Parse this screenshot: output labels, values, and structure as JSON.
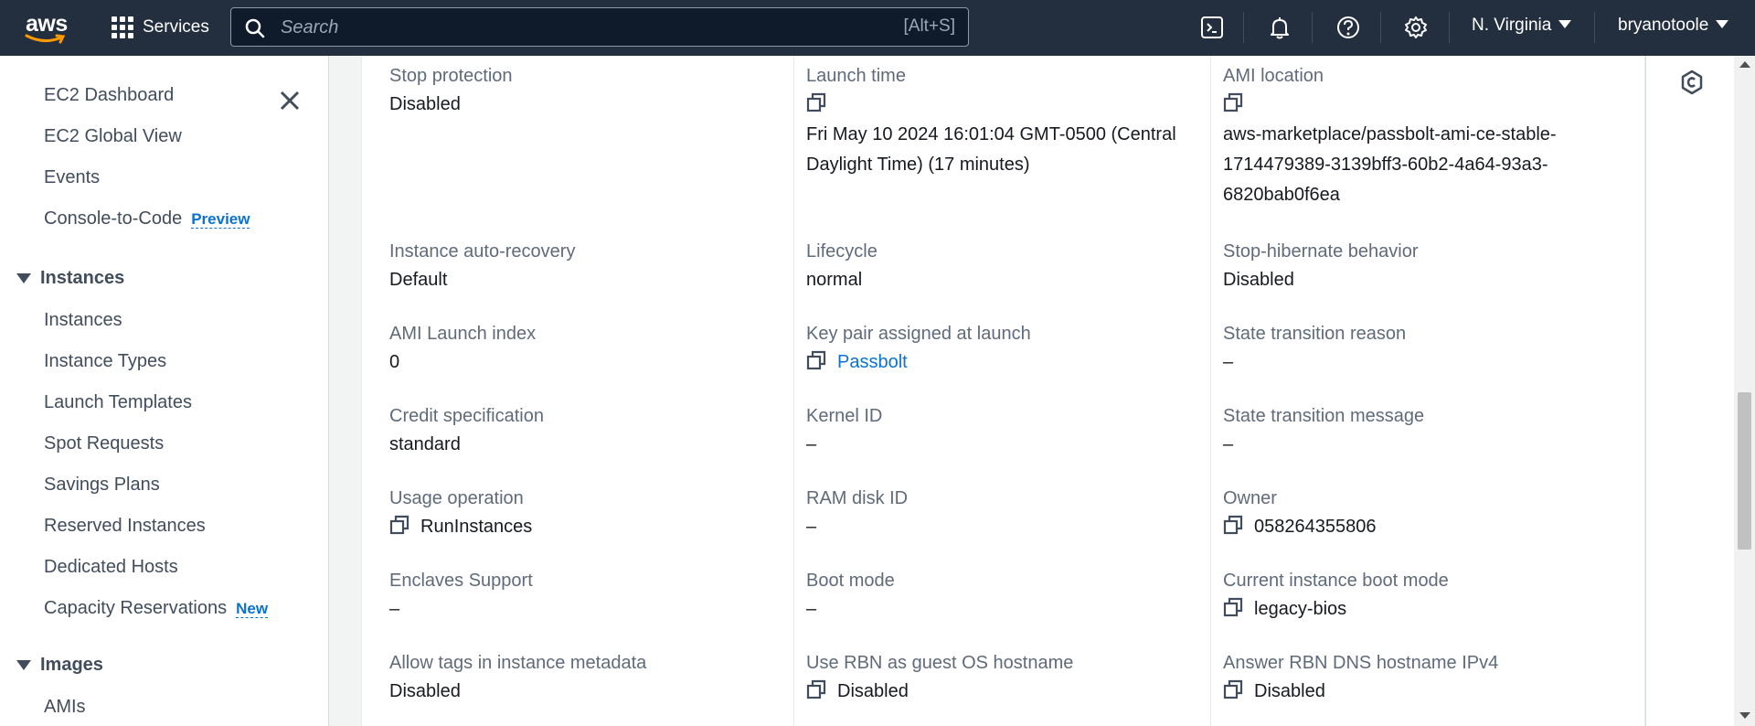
{
  "topnav": {
    "logo_text": "aws",
    "services_label": "Services",
    "search_placeholder": "Search",
    "search_shortcut": "[Alt+S]",
    "region": "N. Virginia",
    "user": "bryanotoole"
  },
  "sidebar": {
    "items_top": [
      {
        "label": "EC2 Dashboard"
      },
      {
        "label": "EC2 Global View"
      },
      {
        "label": "Events"
      },
      {
        "label": "Console-to-Code",
        "badge": "Preview"
      }
    ],
    "instances_section": "Instances",
    "instances_items": [
      {
        "label": "Instances"
      },
      {
        "label": "Instance Types"
      },
      {
        "label": "Launch Templates"
      },
      {
        "label": "Spot Requests"
      },
      {
        "label": "Savings Plans"
      },
      {
        "label": "Reserved Instances"
      },
      {
        "label": "Dedicated Hosts"
      },
      {
        "label": "Capacity Reservations",
        "badge": "New"
      }
    ],
    "images_section": "Images",
    "images_items": [
      {
        "label": "AMIs"
      }
    ]
  },
  "details": {
    "col1": [
      {
        "label": "Stop protection",
        "value": "Disabled"
      },
      {
        "label": "Instance auto-recovery",
        "value": "Default"
      },
      {
        "label": "AMI Launch index",
        "value": "0"
      },
      {
        "label": "Credit specification",
        "value": "standard"
      },
      {
        "label": "Usage operation",
        "value": "RunInstances"
      },
      {
        "label": "Enclaves Support",
        "value": "–"
      },
      {
        "label": "Allow tags in instance metadata",
        "value": "Disabled"
      }
    ],
    "col2": [
      {
        "label": "Launch time",
        "value_line1": "Fri May 10 2024 16:01:04 GMT-0500 (Central",
        "value_line2": "Daylight Time) (17 minutes)"
      },
      {
        "label": "Lifecycle",
        "value": "normal"
      },
      {
        "label": "Key pair assigned at launch",
        "value": "Passbolt"
      },
      {
        "label": "Kernel ID",
        "value": "–"
      },
      {
        "label": "RAM disk ID",
        "value": "–"
      },
      {
        "label": "Boot mode",
        "value": "–"
      },
      {
        "label": "Use RBN as guest OS hostname",
        "value": "Disabled"
      }
    ],
    "col3": [
      {
        "label": "AMI location",
        "value_line1": "aws-marketplace/passbolt-ami-ce-stable-",
        "value_line2": "1714479389-3139bff3-60b2-4a64-93a3-",
        "value_line3": "6820bab0f6ea"
      },
      {
        "label": "Stop-hibernate behavior",
        "value": "Disabled"
      },
      {
        "label": "State transition reason",
        "value": "–"
      },
      {
        "label": "State transition message",
        "value": "–"
      },
      {
        "label": "Owner",
        "value": "058264355806"
      },
      {
        "label": "Current instance boot mode",
        "value": "legacy-bios"
      },
      {
        "label": "Answer RBN DNS hostname IPv4",
        "value": "Disabled"
      }
    ]
  }
}
